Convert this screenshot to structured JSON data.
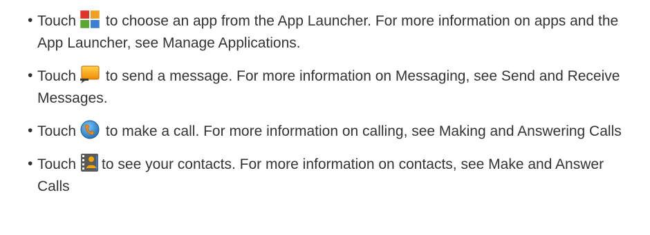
{
  "bullets": [
    {
      "icon": "app-launcher-icon",
      "before": "Touch",
      "after": " to choose an app from the App Launcher. For more information on apps and the App Launcher, see Manage Applications."
    },
    {
      "icon": "messaging-icon",
      "before": "Touch",
      "after": " to send a message. For more information on Messaging, see Send and Receive Messages."
    },
    {
      "icon": "phone-icon",
      "before": "Touch",
      "after": " to make a call. For more information on calling, see Making and Answering Calls"
    },
    {
      "icon": "contacts-icon",
      "before": "Touch",
      "after": "to see your contacts. For more information on contacts, see Make and Answer Calls"
    }
  ],
  "colors": {
    "text": "#333333",
    "launcher_red": "#e0332a",
    "launcher_green": "#5aa832",
    "launcher_blue": "#3a7fd0",
    "launcher_orange": "#f0a020",
    "message_orange": "#f5a400",
    "phone_blue": "#2a8fd6",
    "phone_orange": "#f08a10"
  }
}
